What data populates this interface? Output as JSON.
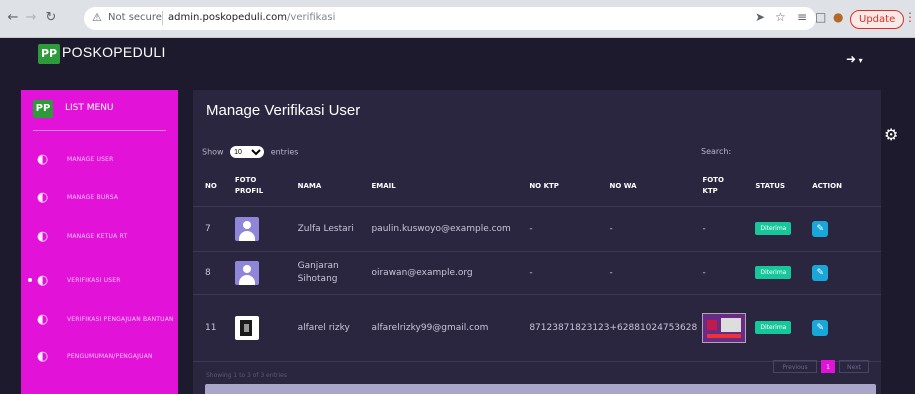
{
  "browser": {
    "security_label": "Not secure",
    "url_host": "admin.poskopeduli.com",
    "url_path": "/verifikasi",
    "update_label": "Update"
  },
  "app": {
    "logo_short": "PP",
    "logo_text": "POSKOPEDULI"
  },
  "sidebar": {
    "title": "LIST MENU",
    "items": [
      {
        "label": "MANAGE USER",
        "active": false
      },
      {
        "label": "MANAGE BURSA",
        "active": false
      },
      {
        "label": "MANAGE KETUA RT",
        "active": false
      },
      {
        "label": "VERIFIKASI USER",
        "active": true
      },
      {
        "label": "VERIFIKASI PENGAJUAN BANTUAN",
        "active": false
      },
      {
        "label": "PENGUMUMAN/PENGAJUAN",
        "active": false
      }
    ]
  },
  "main": {
    "title": "Manage Verifikasi User",
    "show_label": "Show",
    "entries_label": "entries",
    "page_size": "10",
    "search_label": "Search:",
    "columns": [
      "NO",
      "FOTO PROFIL",
      "NAMA",
      "EMAIL",
      "NO KTP",
      "NO WA",
      "FOTO KTP",
      "STATUS",
      "ACTION"
    ],
    "rows": [
      {
        "no": "7",
        "nama": "Zulfa Lestari",
        "email": "paulin.kuswoyo@example.com",
        "no_ktp": "-",
        "no_wa": "-",
        "foto_ktp": "-",
        "status": "Diterima"
      },
      {
        "no": "8",
        "nama": "Ganjaran Sihotang",
        "email": "oirawan@example.org",
        "no_ktp": "-",
        "no_wa": "-",
        "foto_ktp": "-",
        "status": "Diterima"
      },
      {
        "no": "11",
        "nama": "alfarel rizky",
        "email": "alfarelrizky99@gmail.com",
        "no_ktp": "87123871823123",
        "no_wa": "+62881024753628",
        "foto_ktp": "",
        "status": "Diterima"
      }
    ],
    "info_text": "Showing 1 to 3 of 3 entries",
    "pagination": {
      "prev": "Previous",
      "page": "1",
      "next": "Next"
    }
  },
  "colors": {
    "accent": "#e312d9",
    "badge": "#16c79a",
    "edit": "#19a7d9",
    "background": "#1d1a2e",
    "card": "#2a2640"
  }
}
